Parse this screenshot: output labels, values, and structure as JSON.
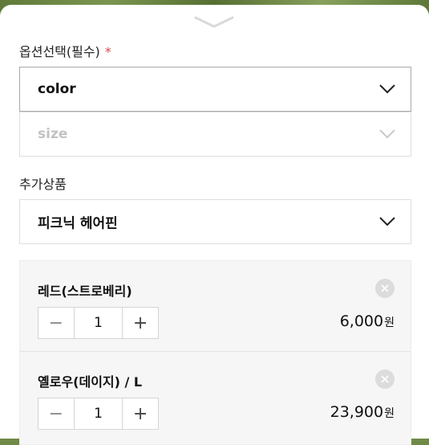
{
  "options": {
    "label": "옵션선택(필수)",
    "required_mark": "*",
    "selects": [
      {
        "value": "color",
        "enabled": true
      },
      {
        "value": "size",
        "enabled": false
      }
    ]
  },
  "addon": {
    "label": "추가상품",
    "select_value": "피크닉 헤어핀"
  },
  "items": [
    {
      "name": "레드(스트로베리)",
      "quantity": "1",
      "price": "6,000",
      "currency": "원",
      "minus": "−",
      "plus": "+"
    },
    {
      "name": "옐로우(데이지) / L",
      "quantity": "1",
      "price": "23,900",
      "currency": "원",
      "minus": "−",
      "plus": "+"
    }
  ],
  "colors": {
    "required_star": "#e0454b",
    "panel_bg": "#f6f6f6",
    "border": "#dedede"
  },
  "icons": [
    "collapse-handle-icon",
    "chevron-down-icon",
    "close-icon"
  ]
}
